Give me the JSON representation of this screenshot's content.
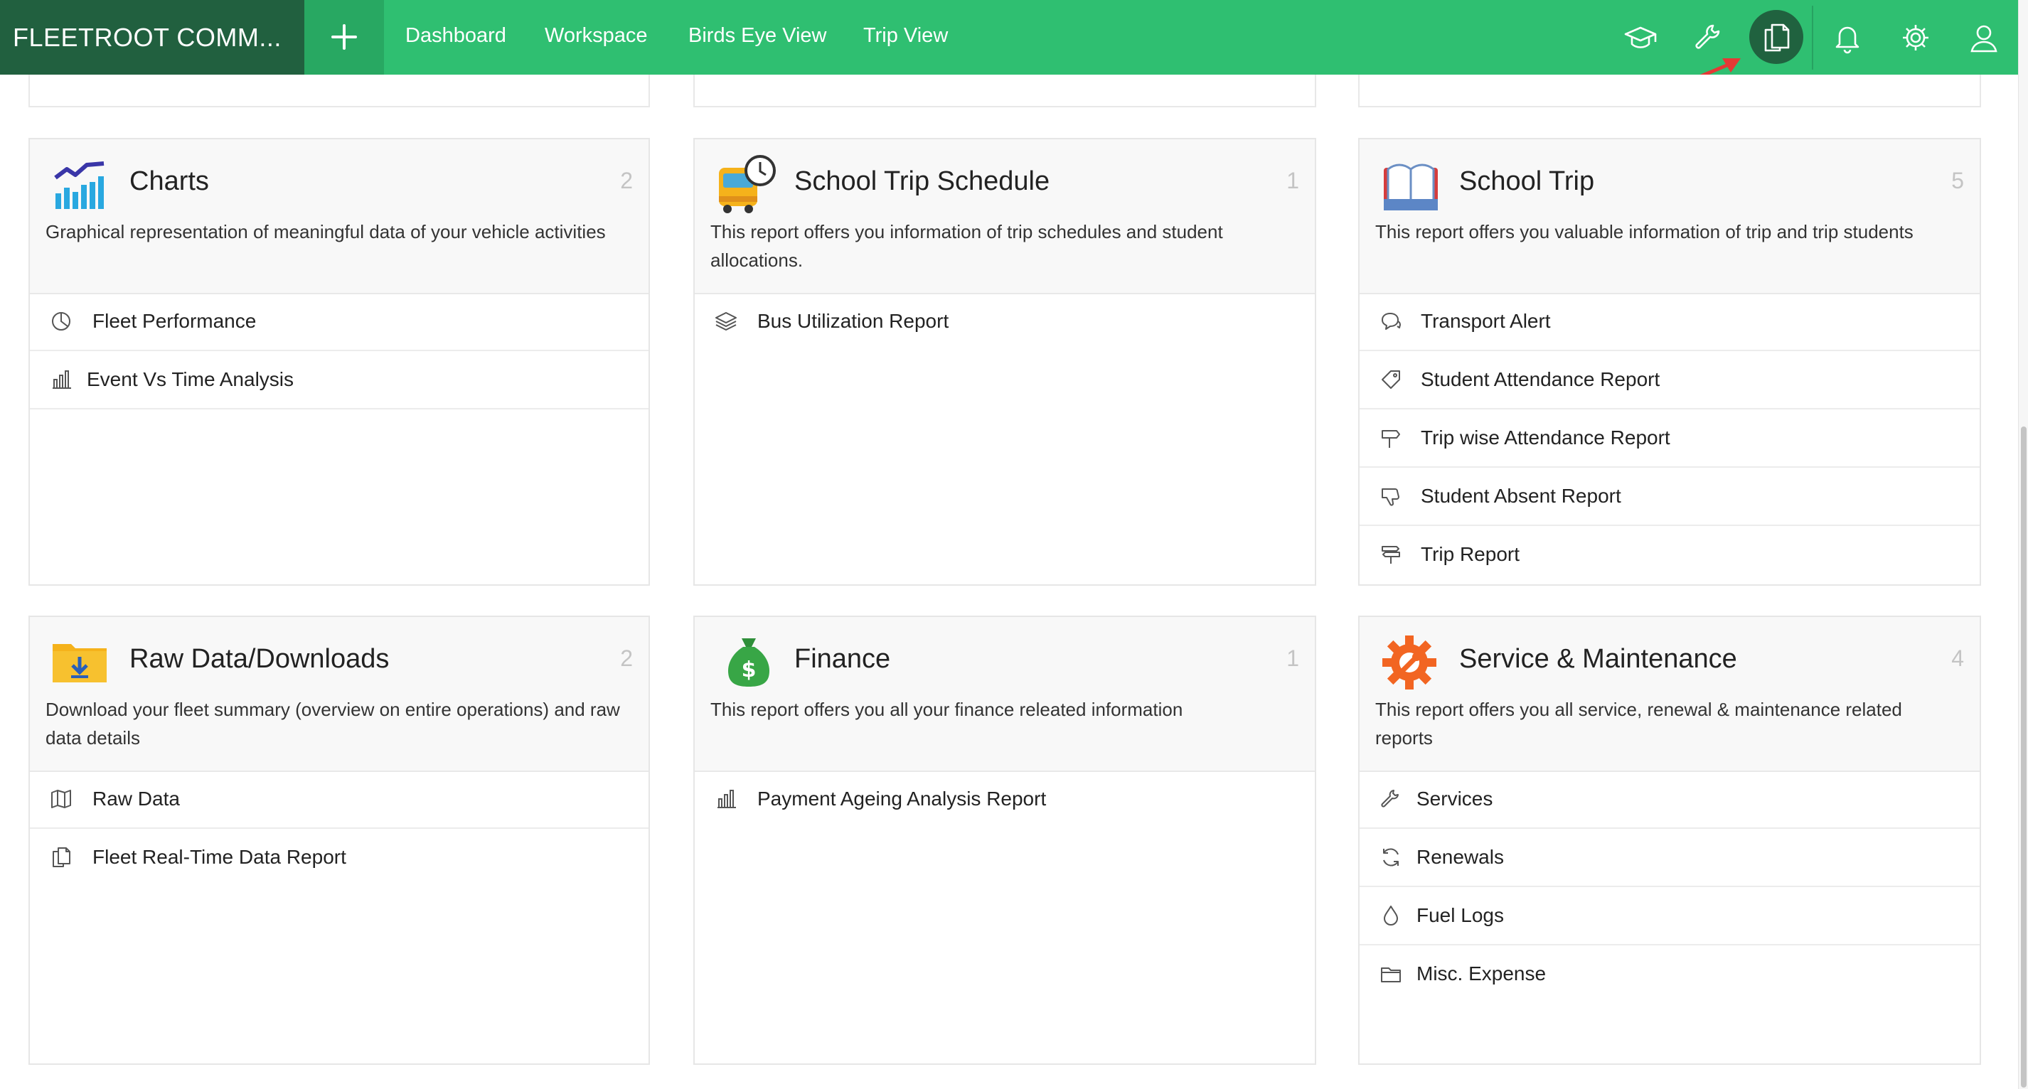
{
  "app": {
    "brand": "FLEETROOT COMM...",
    "nav": [
      {
        "label": "Dashboard"
      },
      {
        "label": "Workspace"
      },
      {
        "label": "Birds Eye View"
      },
      {
        "label": "Trip View"
      }
    ],
    "icons": [
      "graduation-cap-icon",
      "wrench-icon",
      "reports-icon",
      "bell-icon",
      "gear-icon",
      "user-icon"
    ],
    "active_icon": "reports-icon",
    "accent_color": "#2fbf71",
    "brand_color": "#21603f"
  },
  "cards": [
    {
      "id": "charts",
      "title": "Charts",
      "count": "2",
      "icon": "chart-icon",
      "description": "Graphical representation of meaningful data of your vehicle activities",
      "items": [
        {
          "label": "Fleet Performance",
          "icon": "pie-icon"
        },
        {
          "label": "Event Vs Time Analysis",
          "icon": "bar-chart-icon"
        }
      ]
    },
    {
      "id": "school-trip-schedule",
      "title": "School Trip Schedule",
      "count": "1",
      "icon": "school-bus-clock-icon",
      "description": "This report offers you information of trip schedules and student allocations.",
      "items": [
        {
          "label": "Bus Utilization Report",
          "icon": "layers-icon"
        }
      ]
    },
    {
      "id": "school-trip",
      "title": "School Trip",
      "count": "5",
      "icon": "open-book-icon",
      "description": "This report offers you valuable information of trip and trip students",
      "items": [
        {
          "label": "Transport Alert",
          "icon": "chat-icon"
        },
        {
          "label": "Student Attendance Report",
          "icon": "tag-icon"
        },
        {
          "label": "Trip wise Attendance Report",
          "icon": "signpost-icon"
        },
        {
          "label": "Student Absent Report",
          "icon": "thumbs-down-icon"
        },
        {
          "label": "Trip Report",
          "icon": "directions-icon"
        }
      ]
    },
    {
      "id": "raw-data",
      "title": "Raw Data/Downloads",
      "count": "2",
      "icon": "download-folder-icon",
      "description": "Download your fleet summary (overview on entire operations) and raw data details",
      "items": [
        {
          "label": "Raw Data",
          "icon": "map-icon"
        },
        {
          "label": "Fleet Real-Time Data Report",
          "icon": "copy-icon"
        }
      ]
    },
    {
      "id": "finance",
      "title": "Finance",
      "count": "1",
      "icon": "money-bag-icon",
      "description": "This report offers you all your finance releated information",
      "items": [
        {
          "label": "Payment Ageing Analysis Report",
          "icon": "bar-chart-icon"
        }
      ]
    },
    {
      "id": "service-maintenance",
      "title": "Service & Maintenance",
      "count": "4",
      "icon": "gear-wrench-icon",
      "description": "This report offers you all service, renewal & maintenance related reports",
      "items": [
        {
          "label": "Services",
          "icon": "wrench-icon"
        },
        {
          "label": "Renewals",
          "icon": "refresh-icon"
        },
        {
          "label": "Fuel Logs",
          "icon": "drop-icon"
        },
        {
          "label": "Misc. Expense",
          "icon": "folder-icon"
        }
      ]
    }
  ]
}
